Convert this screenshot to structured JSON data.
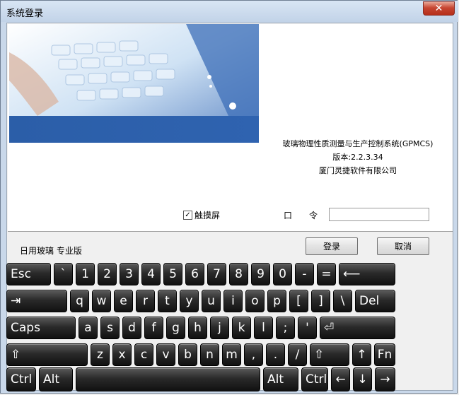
{
  "window": {
    "title": "系统登录",
    "close_label": "✕"
  },
  "info": {
    "line1": "玻璃物理性质测量与生产控制系统(GPMCS)",
    "line2": "版本:2.2.3.34",
    "line3": "厦门灵捷软件有限公司"
  },
  "touch": {
    "check": "✓",
    "label": "触摸屏"
  },
  "password": {
    "label1": "口",
    "label2": "令",
    "value": ""
  },
  "edition": "日用玻璃 专业版",
  "buttons": {
    "login": "登录",
    "cancel": "取消"
  },
  "keyboard": {
    "row1": [
      "Esc",
      "`",
      "1",
      "2",
      "3",
      "4",
      "5",
      "6",
      "7",
      "8",
      "9",
      "0",
      "-",
      "=",
      "⟵"
    ],
    "row2": [
      "⇥",
      "q",
      "w",
      "e",
      "r",
      "t",
      "y",
      "u",
      "i",
      "o",
      "p",
      "[",
      "]",
      "\\",
      "Del"
    ],
    "row3": [
      "Caps",
      "a",
      "s",
      "d",
      "f",
      "g",
      "h",
      "j",
      "k",
      "l",
      ";",
      "'",
      "⏎"
    ],
    "row4": [
      "⇧",
      "z",
      "x",
      "c",
      "v",
      "b",
      "n",
      "m",
      ",",
      ".",
      "/",
      "⇧",
      "↑",
      "Fn"
    ],
    "row5": [
      "Ctrl",
      "Alt",
      "",
      "Alt",
      "Ctrl",
      "←",
      "↓",
      "→"
    ]
  }
}
